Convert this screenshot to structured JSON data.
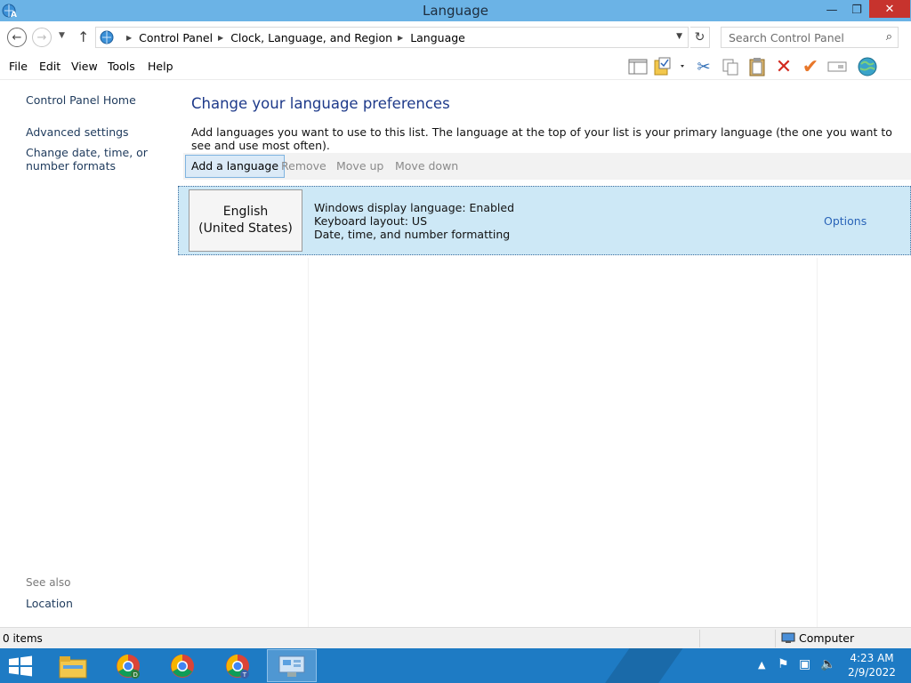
{
  "window": {
    "title": "Language",
    "min_glyph": "—",
    "max_glyph": "❐",
    "close_glyph": "✕"
  },
  "address": {
    "crumbs": [
      "Control Panel",
      "Clock, Language, and Region",
      "Language"
    ],
    "search_placeholder": "Search Control Panel"
  },
  "menu": {
    "items": [
      "File",
      "Edit",
      "View",
      "Tools",
      "Help"
    ]
  },
  "toolbar": {
    "icons": [
      "preview-pane-icon",
      "properties-folder-icon",
      "cut-icon",
      "copy-icon",
      "paste-icon",
      "delete-icon",
      "checkmark-icon",
      "rename-icon",
      "globe-icon"
    ]
  },
  "sidebar": {
    "links": [
      "Control Panel Home",
      "Advanced settings",
      "Change date, time, or number formats"
    ],
    "see_also_label": "See also",
    "see_also_links": [
      "Location"
    ]
  },
  "content": {
    "heading": "Change your language preferences",
    "description": "Add languages you want to use to this list. The language at the top of your list is your primary language (the one you want to see and use most often).",
    "commands": {
      "add": "Add a language",
      "remove": "Remove",
      "move_up": "Move up",
      "move_down": "Move down"
    },
    "languages": [
      {
        "name": "English (United States)",
        "details": [
          "Windows display language: Enabled",
          "Keyboard layout: US",
          "Date, time, and number formatting"
        ],
        "options_label": "Options"
      }
    ]
  },
  "status": {
    "items": "0 items",
    "location": "Computer"
  },
  "taskbar": {
    "apps": [
      "file-explorer-icon",
      "chrome-profile-d-icon",
      "chrome-icon",
      "chrome-profile-t-icon",
      "control-panel-icon"
    ],
    "time": "4:23 AM",
    "date": "2/9/2022"
  },
  "colors": {
    "titlebar": "#6bb3e6",
    "selected_row": "#cde8f6",
    "heading": "#1e3a8a",
    "link": "#2a64b8",
    "taskbar": "#1e7bc4",
    "close": "#c7332d"
  }
}
